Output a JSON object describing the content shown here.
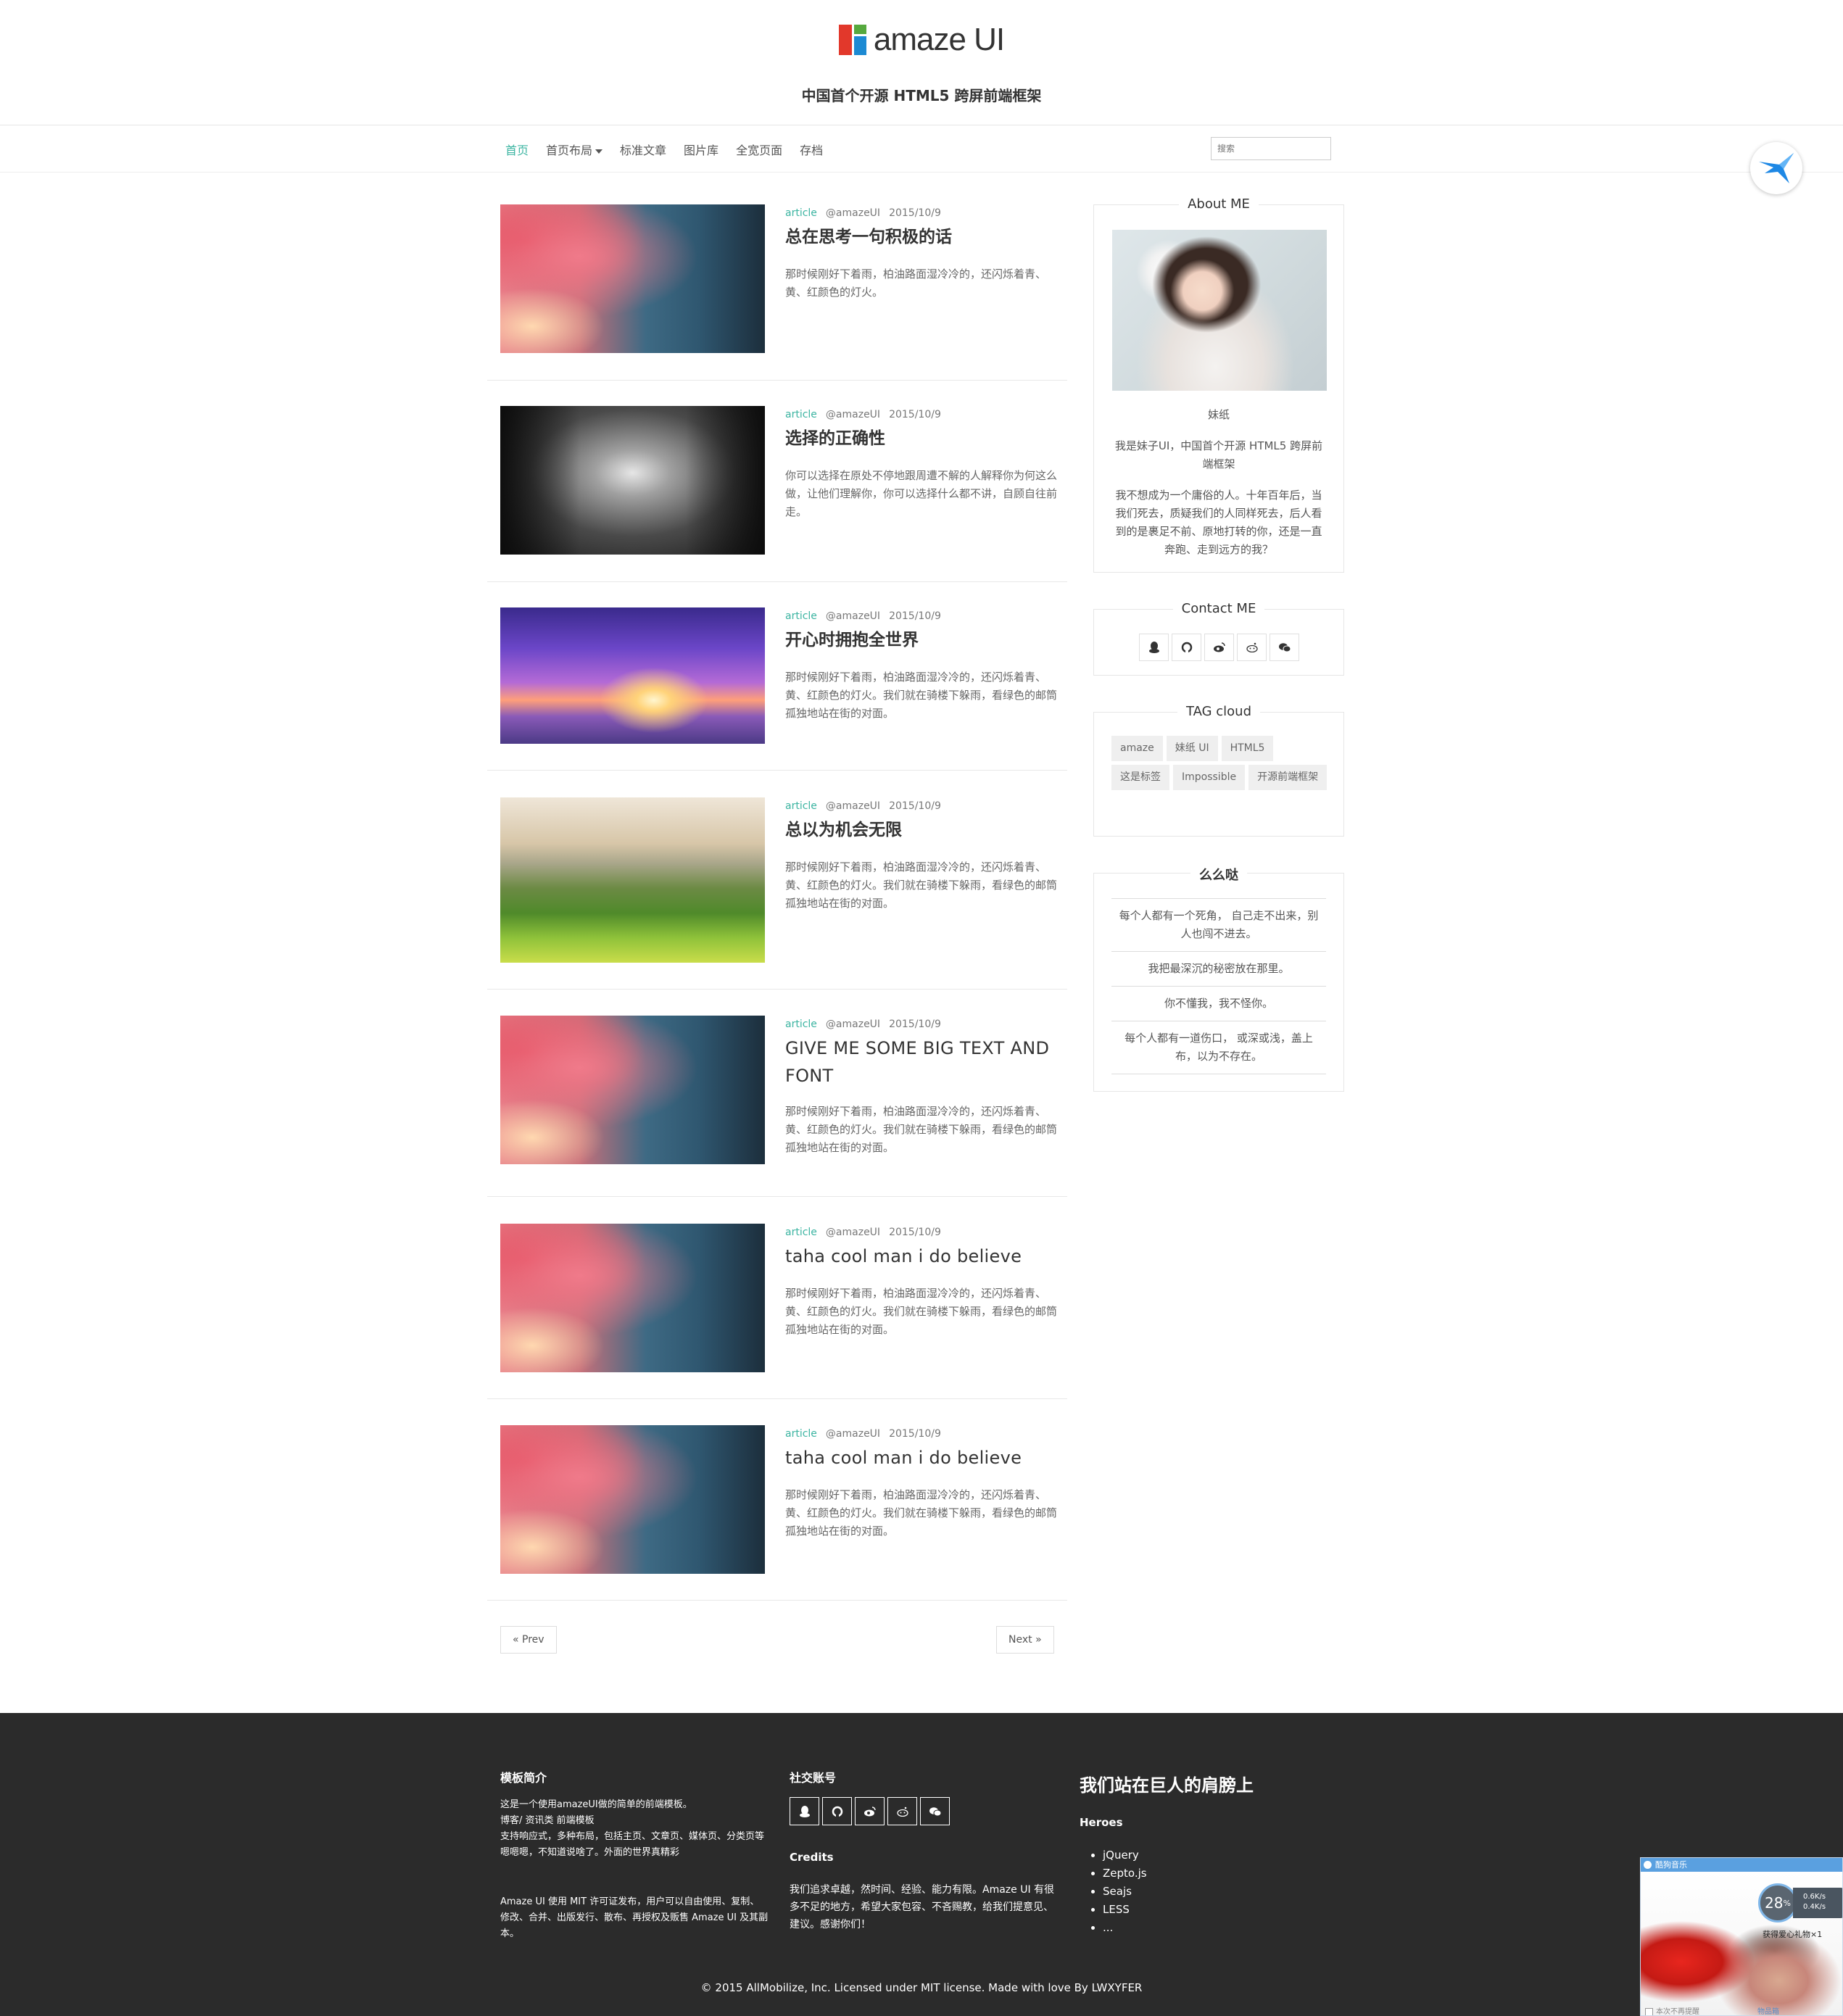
{
  "brand": {
    "name": "amaze UI",
    "tagline": "中国首个开源 HTML5 跨屏前端框架"
  },
  "nav": {
    "items": [
      "首页",
      "首页布局",
      "标准文章",
      "图片库",
      "全宽页面",
      "存档"
    ],
    "search_placeholder": "搜索"
  },
  "articles": [
    {
      "category": "article",
      "author": "@amazeUI",
      "date": "2015/10/9",
      "title": "总在思考一句积极的话",
      "image": "cherry-blossom-forest",
      "text": "那时候刚好下着雨，柏油路面湿冷冷的，还闪烁着青、黄、红颜色的灯火。"
    },
    {
      "category": "article",
      "author": "@amazeUI",
      "date": "2015/10/9",
      "title": "选择的正确性",
      "image": "city-street-bw",
      "text": "你可以选择在原处不停地跟周遭不解的人解释你为何这么做，让他们理解你，你可以选择什么都不讲，自顾自往前走。"
    },
    {
      "category": "article",
      "author": "@amazeUI",
      "date": "2015/10/9",
      "title": "开心时拥抱全世界",
      "image": "purple-sunset",
      "text": "那时候刚好下着雨，柏油路面湿冷冷的，还闪烁着青、黄、红颜色的灯火。我们就在骑楼下躲雨，看绿色的邮筒孤独地站在街的对面。"
    },
    {
      "category": "article",
      "author": "@amazeUI",
      "date": "2015/10/9",
      "title": "总以为机会无限",
      "image": "green-hills",
      "text": "那时候刚好下着雨，柏油路面湿冷冷的，还闪烁着青、黄、红颜色的灯火。我们就在骑楼下躲雨，看绿色的邮筒孤独地站在街的对面。"
    },
    {
      "category": "article",
      "author": "@amazeUI",
      "date": "2015/10/9",
      "title": "GIVE ME SOME BIG TEXT AND FONT",
      "image": "cherry-blossom-forest",
      "text": "那时候刚好下着雨，柏油路面湿冷冷的，还闪烁着青、黄、红颜色的灯火。我们就在骑楼下躲雨，看绿色的邮筒孤独地站在街的对面。"
    },
    {
      "category": "article",
      "author": "@amazeUI",
      "date": "2015/10/9",
      "title": "taha cool man i do believe",
      "image": "cherry-blossom-forest",
      "text": "那时候刚好下着雨，柏油路面湿冷冷的，还闪烁着青、黄、红颜色的灯火。我们就在骑楼下躲雨，看绿色的邮筒孤独地站在街的对面。"
    },
    {
      "category": "article",
      "author": "@amazeUI",
      "date": "2015/10/9",
      "title": "taha cool man i do believe",
      "image": "cherry-blossom-forest",
      "text": "那时候刚好下着雨，柏油路面湿冷冷的，还闪烁着青、黄、红颜色的灯火。我们就在骑楼下躲雨，看绿色的邮筒孤独地站在街的对面。"
    }
  ],
  "pager": {
    "prev": "« Prev",
    "next": "Next »"
  },
  "sidebar": {
    "about": {
      "title": "About ME",
      "name": "妹纸",
      "intro": "我是妹子UI，中国首个开源 HTML5 跨屏前端框架",
      "bio": "我不想成为一个庸俗的人。十年百年后，当我们死去，质疑我们的人同样死去，后人看到的是裹足不前、原地打转的你，还是一直奔跑、走到远方的我？"
    },
    "contact": {
      "title": "Contact ME",
      "icons": [
        "qq-icon",
        "github-icon",
        "weibo-icon",
        "reddit-icon",
        "wechat-icon"
      ]
    },
    "tags": {
      "title": "TAG cloud",
      "items": [
        "amaze",
        "妹纸 UI",
        "HTML5",
        "这是标签",
        "Impossible",
        "开源前端框架"
      ]
    },
    "quotes": {
      "title": "么么哒",
      "items": [
        "每个人都有一个死角， 自己走不出来，别人也闯不进去。",
        "我把最深沉的秘密放在那里。",
        "你不懂我，我不怪你。",
        "每个人都有一道伤口， 或深或浅，盖上布，以为不存在。"
      ]
    }
  },
  "footer": {
    "intro_title": "模板简介",
    "intro_lines": [
      "这是一个使用amazeUI做的简单的前端模板。",
      "博客/ 资讯类 前端模板",
      "支持响应式，多种布局，包括主页、文章页、媒体页、分类页等",
      "嗯嗯嗯，不知道说啥了。外面的世界真精彩"
    ],
    "license_text": "Amaze UI 使用 MIT 许可证发布，用户可以自由使用、复制、修改、合并、出版发行、散布、再授权及贩售 Amaze UI 及其副本。",
    "social_title": "社交账号",
    "credits_title": "Credits",
    "credits_text": "我们追求卓越，然时间、经验、能力有限。Amaze UI 有很多不足的地方，希望大家包容、不吝赐教，给我们提意见、建议。感谢你们！",
    "giants_title": "我们站在巨人的肩膀上",
    "heroes_title": "Heroes",
    "heroes": [
      "jQuery",
      "Zepto.js",
      "Seajs",
      "LESS",
      "..."
    ],
    "copyright": "© 2015 AllMobilize, Inc. Licensed under MIT license. Made with love By LWXYFER"
  },
  "popup": {
    "title": "酷狗音乐",
    "gauge": "28",
    "gauge_unit": "%",
    "speed_up": "0.6K/s",
    "speed_down": "0.4K/s",
    "promo": "获得爱心礼物×1",
    "checkbox": "本次不再提醒",
    "link": "物品箱"
  }
}
